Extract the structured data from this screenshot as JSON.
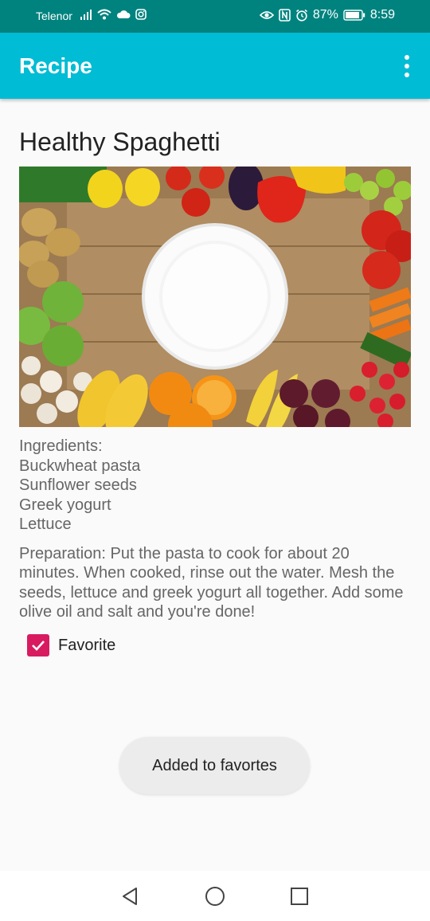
{
  "status": {
    "carrier": "Telenor",
    "battery_percent": "87%",
    "time": "8:59",
    "icons": [
      "signal-icon",
      "wifi-icon",
      "cloud-icon",
      "instagram-icon",
      "eye-icon",
      "nfc-icon",
      "alarm-icon",
      "battery-icon"
    ]
  },
  "appbar": {
    "title": "Recipe",
    "menu_icon": "overflow-menu-icon",
    "color": "#00bcd4"
  },
  "recipe": {
    "title": "Healthy Spaghetti",
    "ingredients_heading": "Ingredients:",
    "ingredients": [
      "Buckwheat pasta",
      "Sunflower seeds",
      "Greek yogurt",
      "Lettuce"
    ],
    "preparation": "Preparation: Put the pasta to cook for about 20 minutes. When cooked, rinse out the water. Mesh the seeds, lettuce and greek yogurt all together. Add some olive oil and salt and you're done!"
  },
  "favorite": {
    "label": "Favorite",
    "checked": true,
    "accent": "#d81b60"
  },
  "toast": {
    "message": "Added to favortes"
  },
  "navbar": {
    "icons": [
      "back-icon",
      "home-icon",
      "recents-icon"
    ]
  }
}
